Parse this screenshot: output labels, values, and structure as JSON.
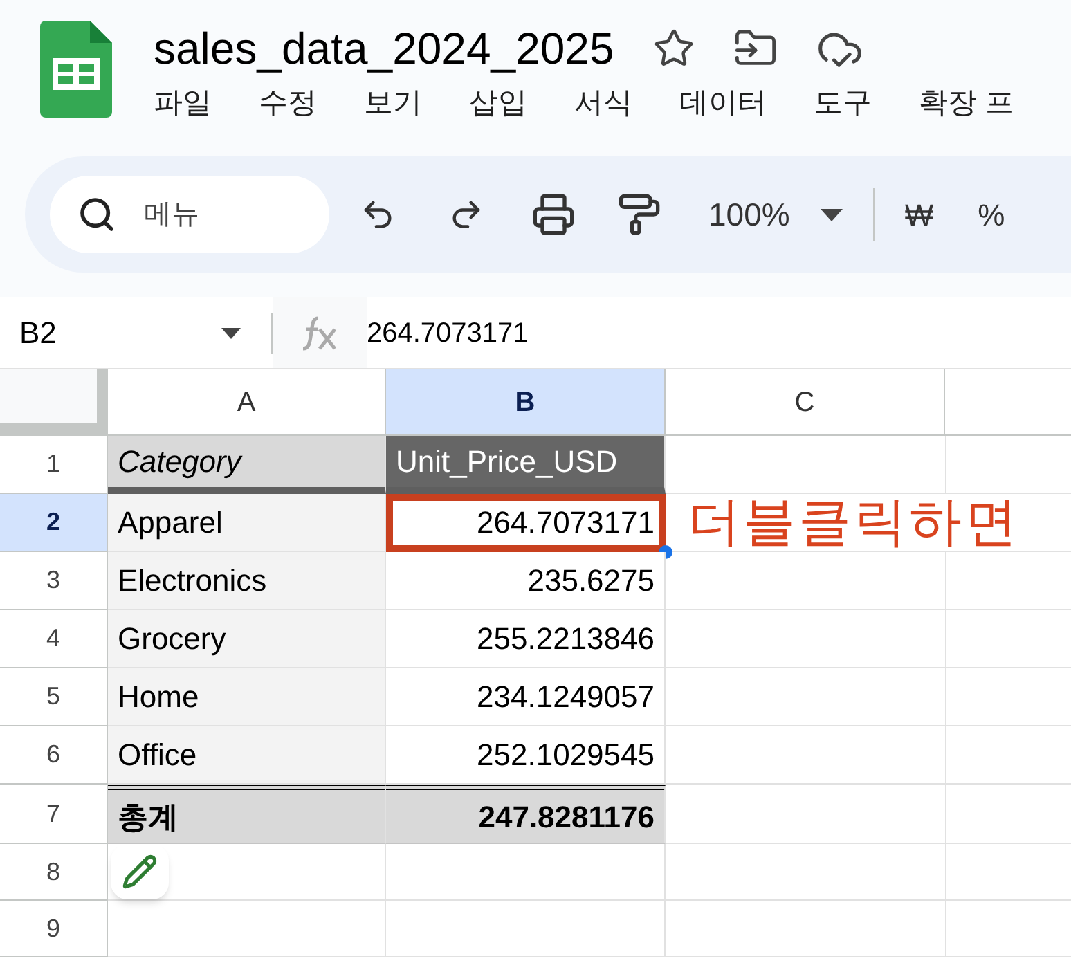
{
  "document": {
    "title": "sales_data_2024_2025"
  },
  "menu": [
    "파일",
    "수정",
    "보기",
    "삽입",
    "서식",
    "데이터",
    "도구",
    "확장 프"
  ],
  "toolbar": {
    "search": {
      "placeholder": "메뉴"
    },
    "zoom": "100%",
    "currency": "₩",
    "percent": "%"
  },
  "formula_bar": {
    "cell_ref": "B2",
    "value": "264.7073171"
  },
  "columns": [
    {
      "label": "A",
      "selected": false
    },
    {
      "label": "B",
      "selected": true
    },
    {
      "label": "C",
      "selected": false
    }
  ],
  "rows": [
    {
      "number": "1",
      "selected": false,
      "kind": "header",
      "cells": [
        {
          "text": "Category",
          "selected": false
        },
        {
          "text": "Unit_Price_USD",
          "selected": false
        }
      ]
    },
    {
      "number": "2",
      "selected": true,
      "kind": "data",
      "cells": [
        {
          "text": "Apparel",
          "selected": false
        },
        {
          "text": "264.7073171",
          "selected": true
        }
      ]
    },
    {
      "number": "3",
      "selected": false,
      "kind": "data",
      "cells": [
        {
          "text": "Electronics",
          "selected": false
        },
        {
          "text": "235.6275",
          "selected": false
        }
      ]
    },
    {
      "number": "4",
      "selected": false,
      "kind": "data",
      "cells": [
        {
          "text": "Grocery",
          "selected": false
        },
        {
          "text": "255.2213846",
          "selected": false
        }
      ]
    },
    {
      "number": "5",
      "selected": false,
      "kind": "data",
      "cells": [
        {
          "text": "Home",
          "selected": false
        },
        {
          "text": "234.1249057",
          "selected": false
        }
      ]
    },
    {
      "number": "6",
      "selected": false,
      "kind": "data",
      "cells": [
        {
          "text": "Office",
          "selected": false
        },
        {
          "text": "252.1029545",
          "selected": false
        }
      ]
    },
    {
      "number": "7",
      "selected": false,
      "kind": "total",
      "cells": [
        {
          "text": "총계",
          "selected": false
        },
        {
          "text": "247.8281176",
          "selected": false
        }
      ]
    },
    {
      "number": "8",
      "selected": false,
      "kind": "empty",
      "cells": []
    },
    {
      "number": "9",
      "selected": false,
      "kind": "empty",
      "cells": []
    }
  ],
  "annotation": "더블클릭하면"
}
